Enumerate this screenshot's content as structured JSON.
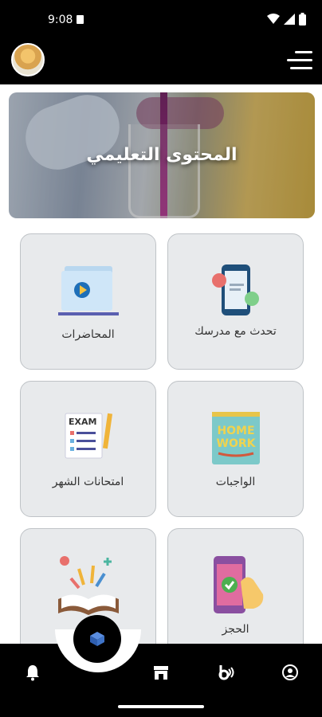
{
  "status_bar": {
    "time": "9:08",
    "icons": [
      "sim-card-icon",
      "wifi-icon",
      "cellular-signal-icon",
      "battery-icon"
    ]
  },
  "header": {
    "avatar": "user-avatar",
    "menu_icon": "hamburger-menu-icon"
  },
  "banner": {
    "title": "المحتوى التعليمي"
  },
  "cards": [
    {
      "id": "chat",
      "label": "تحدث مع مدرسك",
      "icon": "phone-chat-icon"
    },
    {
      "id": "lectures",
      "label": "المحاضرات",
      "icon": "video-folder-icon"
    },
    {
      "id": "homework",
      "label": "الواجبات",
      "icon": "homework-notebook-icon"
    },
    {
      "id": "exams",
      "label": "امتحانات الشهر",
      "icon": "exam-checklist-icon"
    },
    {
      "id": "booking",
      "label": "الحجز",
      "icon": "phone-tap-icon"
    },
    {
      "id": "books",
      "label": "",
      "icon": "open-book-icon"
    }
  ],
  "bottom_nav": {
    "center": "cube-icon",
    "items": [
      "bell-icon",
      "store-icon",
      "beats-icon",
      "profile-icon"
    ]
  },
  "colors": {
    "bar_background": "#000000",
    "card_background": "#e8eaec",
    "card_border": "#bfc3c7",
    "label_text": "#333333"
  }
}
